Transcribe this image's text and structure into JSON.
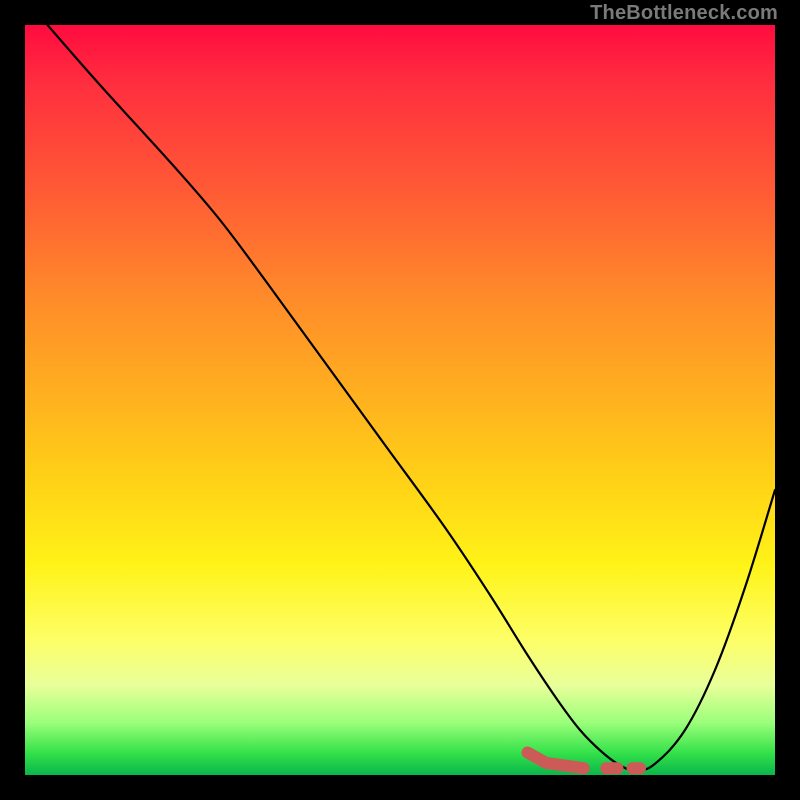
{
  "watermark": "TheBottleneck.com",
  "chart_data": {
    "type": "line",
    "title": "",
    "xlabel": "",
    "ylabel": "",
    "xlim": [
      0,
      100
    ],
    "ylim": [
      0,
      100
    ],
    "grid": false,
    "legend": false,
    "series": [
      {
        "name": "main-curve",
        "color": "#000000",
        "x": [
          3,
          10,
          20,
          26,
          32,
          40,
          48,
          56,
          62,
          67,
          71,
          74,
          77,
          79.5,
          81.5,
          84,
          88,
          92,
          96,
          100
        ],
        "y": [
          100,
          92,
          81,
          74,
          66,
          55,
          44,
          33,
          24,
          16,
          10,
          6,
          3,
          1.2,
          0.6,
          1.5,
          6,
          14,
          25,
          38
        ]
      },
      {
        "name": "highlight-dashes",
        "color": "#cc5a57",
        "style": "dashed",
        "segments": [
          {
            "x": [
              67,
              69.5
            ],
            "y": [
              3.0,
              1.6
            ]
          },
          {
            "x": [
              69.5,
              74.5
            ],
            "y": [
              1.6,
              0.9
            ]
          },
          {
            "x": [
              77.5,
              79.0
            ],
            "y": [
              0.9,
              0.9
            ]
          },
          {
            "x": [
              81.0,
              82.0
            ],
            "y": [
              0.9,
              0.9
            ]
          }
        ]
      }
    ]
  }
}
